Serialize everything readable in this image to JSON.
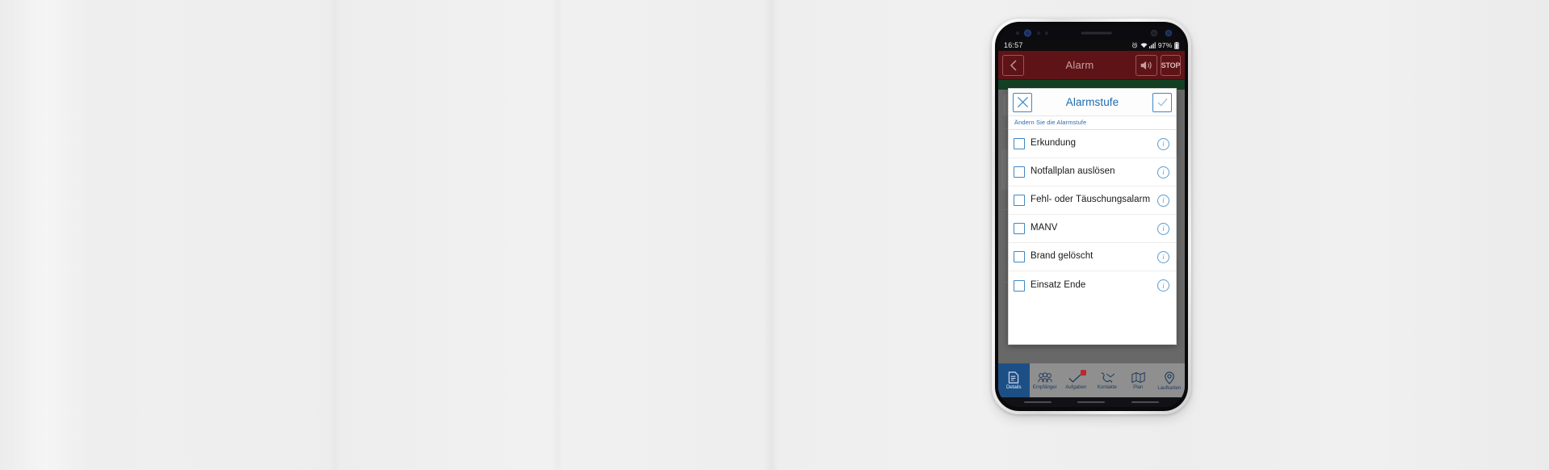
{
  "page": {
    "background_color": "#eeeeee"
  },
  "phone": {
    "status_bar": {
      "time": "16:57",
      "battery_percent": "97%",
      "icons": [
        "alarm-icon",
        "wifi-icon",
        "signal-icon",
        "battery-icon"
      ]
    },
    "app_header": {
      "back_icon": "chevron-left-icon",
      "title": "Alarm",
      "sound_icon": "speaker-icon",
      "stop_label": "STOP",
      "background_color": "#5e1417"
    },
    "dialog": {
      "close_icon": "close-x-icon",
      "title": "Alarmstufe",
      "confirm_icon": "check-icon",
      "subtitle": "Ändern Sie die Alarmstufe",
      "accent_color": "#1b6aad",
      "options": [
        {
          "label": "Erkundung",
          "checked": false,
          "info_icon": "info-icon"
        },
        {
          "label": "Notfallplan auslösen",
          "checked": false,
          "info_icon": "info-icon"
        },
        {
          "label": "Fehl- oder Täuschungsalarm",
          "checked": false,
          "info_icon": "info-icon"
        },
        {
          "label": "MANV",
          "checked": false,
          "info_icon": "info-icon"
        },
        {
          "label": "Brand gelöscht",
          "checked": false,
          "info_icon": "info-icon"
        },
        {
          "label": "Einsatz Ende",
          "checked": false,
          "info_icon": "info-icon"
        }
      ]
    },
    "bottom_nav": {
      "active_color": "#1d4f87",
      "items": [
        {
          "label": "Details",
          "icon": "document-icon",
          "active": true,
          "badge": false
        },
        {
          "label": "Empfänger",
          "icon": "people-icon",
          "active": false,
          "badge": false
        },
        {
          "label": "Aufgaben",
          "icon": "checkmark-icon",
          "active": false,
          "badge": true
        },
        {
          "label": "Kontakte",
          "icon": "phone-icon",
          "active": false,
          "badge": false
        },
        {
          "label": "Plan",
          "icon": "map-icon",
          "active": false,
          "badge": false
        },
        {
          "label": "Laufkarten",
          "icon": "pin-icon",
          "active": false,
          "badge": false
        }
      ]
    }
  }
}
